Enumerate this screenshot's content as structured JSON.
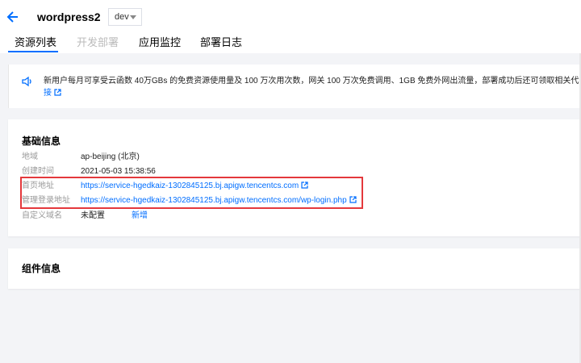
{
  "header": {
    "title": "wordpress2",
    "env_value": "dev"
  },
  "tabs": [
    {
      "label": "资源列表",
      "state": "active"
    },
    {
      "label": "开发部署",
      "state": "disabled"
    },
    {
      "label": "应用监控",
      "state": "normal"
    },
    {
      "label": "部署日志",
      "state": "normal"
    }
  ],
  "notice": {
    "text": "新用户每月可享受云函数 40万GBs 的免费资源使用量及 100 万次用次数，网关 100 万次免费调用、1GB 免费外网出流量，部署成功后还可领取相关代金券。 获取详",
    "link_label": "接"
  },
  "basic_info": {
    "title": "基础信息",
    "rows": [
      {
        "label": "地域",
        "value": "ap-beijing (北京)"
      },
      {
        "label": "创建时间",
        "value": "2021-05-03 15:38:56"
      },
      {
        "label": "首页地址",
        "value": "https://service-hgedkaiz-1302845125.bj.apigw.tencentcs.com"
      },
      {
        "label": "管理登录地址",
        "value": "https://service-hgedkaiz-1302845125.bj.apigw.tencentcs.com/wp-login.php"
      },
      {
        "label": "自定义域名",
        "value": "未配置",
        "action": "新增"
      }
    ]
  },
  "components": {
    "title": "组件信息"
  },
  "colors": {
    "accent": "#006eff",
    "highlight": "#e4393c"
  }
}
